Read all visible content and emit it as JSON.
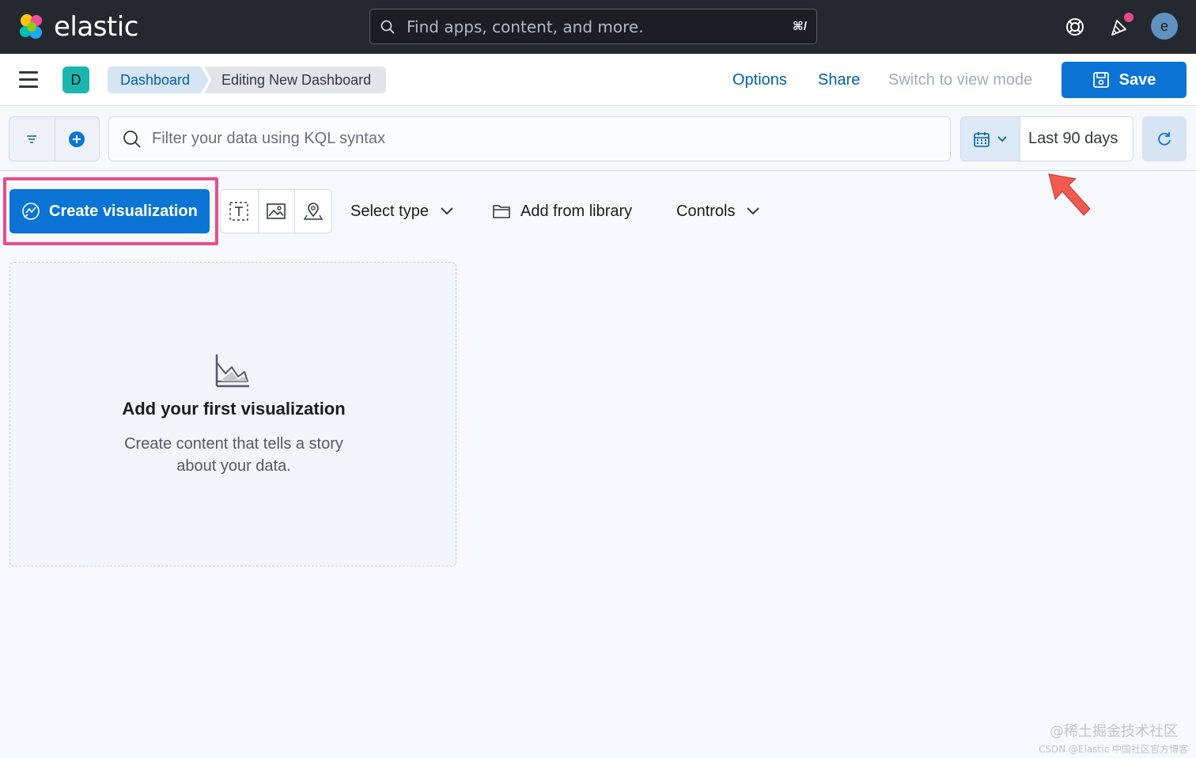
{
  "header": {
    "logo_text": "elastic",
    "search_placeholder": "Find apps, content, and more.",
    "search_shortcut": "⌘/",
    "avatar_initial": "e",
    "icons": [
      "help-icon",
      "newsfeed-icon",
      "user-avatar"
    ]
  },
  "subheader": {
    "space_initial": "D",
    "breadcrumbs": [
      "Dashboard",
      "Editing New Dashboard"
    ],
    "options": "Options",
    "share": "Share",
    "switch_view": "Switch to view mode",
    "save": "Save"
  },
  "querybar": {
    "kql_placeholder": "Filter your data using KQL syntax",
    "date_range": "Last 90 days"
  },
  "toolbar": {
    "create_visualization": "Create visualization",
    "select_type": "Select type",
    "add_from_library": "Add from library",
    "controls": "Controls"
  },
  "empty_state": {
    "title": "Add your first visualization",
    "description": "Create content that tells a story about your data."
  },
  "watermark": {
    "line1": "@稀土掘金技术社区",
    "line2": "CSDN @Elastic 中国社区官方博客"
  },
  "colors": {
    "primary": "#0b74d5",
    "highlight": "#ea4c89",
    "header_bg": "#25282f",
    "arrow": "#f05a4f"
  }
}
